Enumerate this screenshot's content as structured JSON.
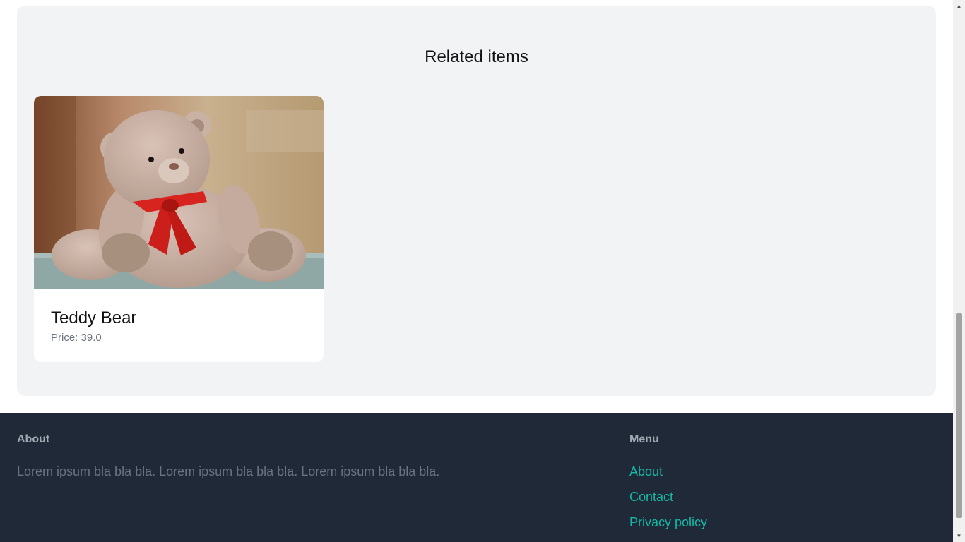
{
  "related": {
    "title": "Related items",
    "items": [
      {
        "name": "Teddy Bear",
        "price_text": "Price: 39.0"
      }
    ]
  },
  "footer": {
    "about": {
      "heading": "About",
      "text": "Lorem ipsum bla bla bla. Lorem ipsum bla bla bla. Lorem ipsum bla bla bla."
    },
    "menu": {
      "heading": "Menu",
      "links": [
        "About",
        "Contact",
        "Privacy policy"
      ]
    }
  },
  "colors": {
    "footer_bg": "#1f2937",
    "link": "#14b8a6",
    "section_bg": "#f2f3f5"
  },
  "icons": {
    "scroll_up": "scroll-up-arrow-icon",
    "scroll_down": "scroll-down-arrow-icon"
  }
}
